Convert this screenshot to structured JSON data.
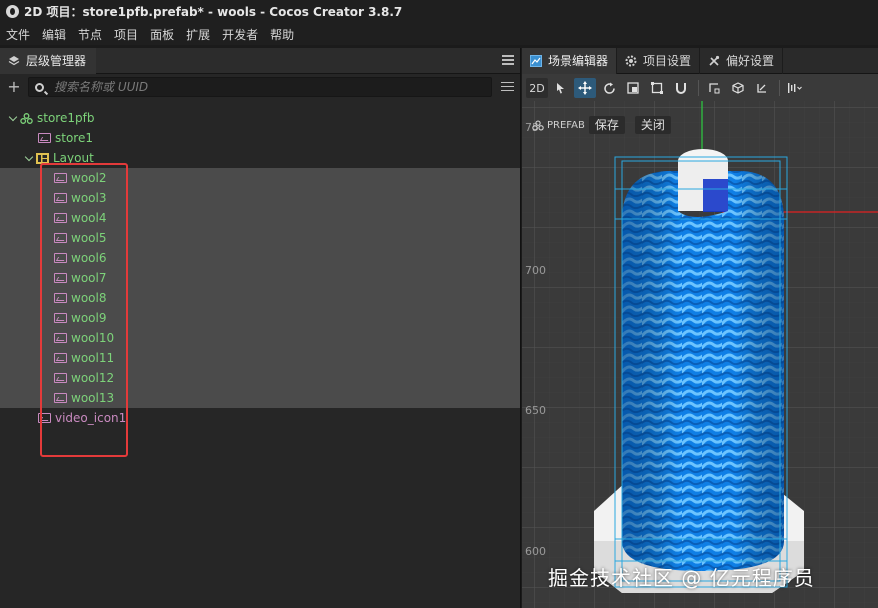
{
  "window": {
    "title": "2D 项目：store1pfb.prefab* - wools - Cocos Creator 3.8.7"
  },
  "menu": [
    "文件",
    "编辑",
    "节点",
    "项目",
    "面板",
    "扩展",
    "开发者",
    "帮助"
  ],
  "hierarchy": {
    "tab_label": "层级管理器",
    "search_placeholder": "搜索名称或 UUID",
    "root": "store1pfb",
    "store_node": "store1",
    "layout_node": "Layout",
    "wools": [
      "wool2",
      "wool3",
      "wool4",
      "wool5",
      "wool6",
      "wool7",
      "wool8",
      "wool9",
      "wool10",
      "wool11",
      "wool12",
      "wool13"
    ],
    "after_node": "video_icon1"
  },
  "right_tabs": [
    "场景编辑器",
    "项目设置",
    "偏好设置"
  ],
  "toolbar": {
    "mode_2d": "2D"
  },
  "scene": {
    "prefab_label": "PREFAB",
    "save_label": "保存",
    "close_label": "关闭",
    "y_labels": [
      "75",
      "700",
      "650",
      "600"
    ]
  },
  "watermark": "掘金技术社区 @ 亿元程序员",
  "colors": {
    "accent_blue": "#1e90ff",
    "node_green": "#7dd37a",
    "node_pink": "#c98ac0",
    "selection_red": "#e33a3a"
  }
}
